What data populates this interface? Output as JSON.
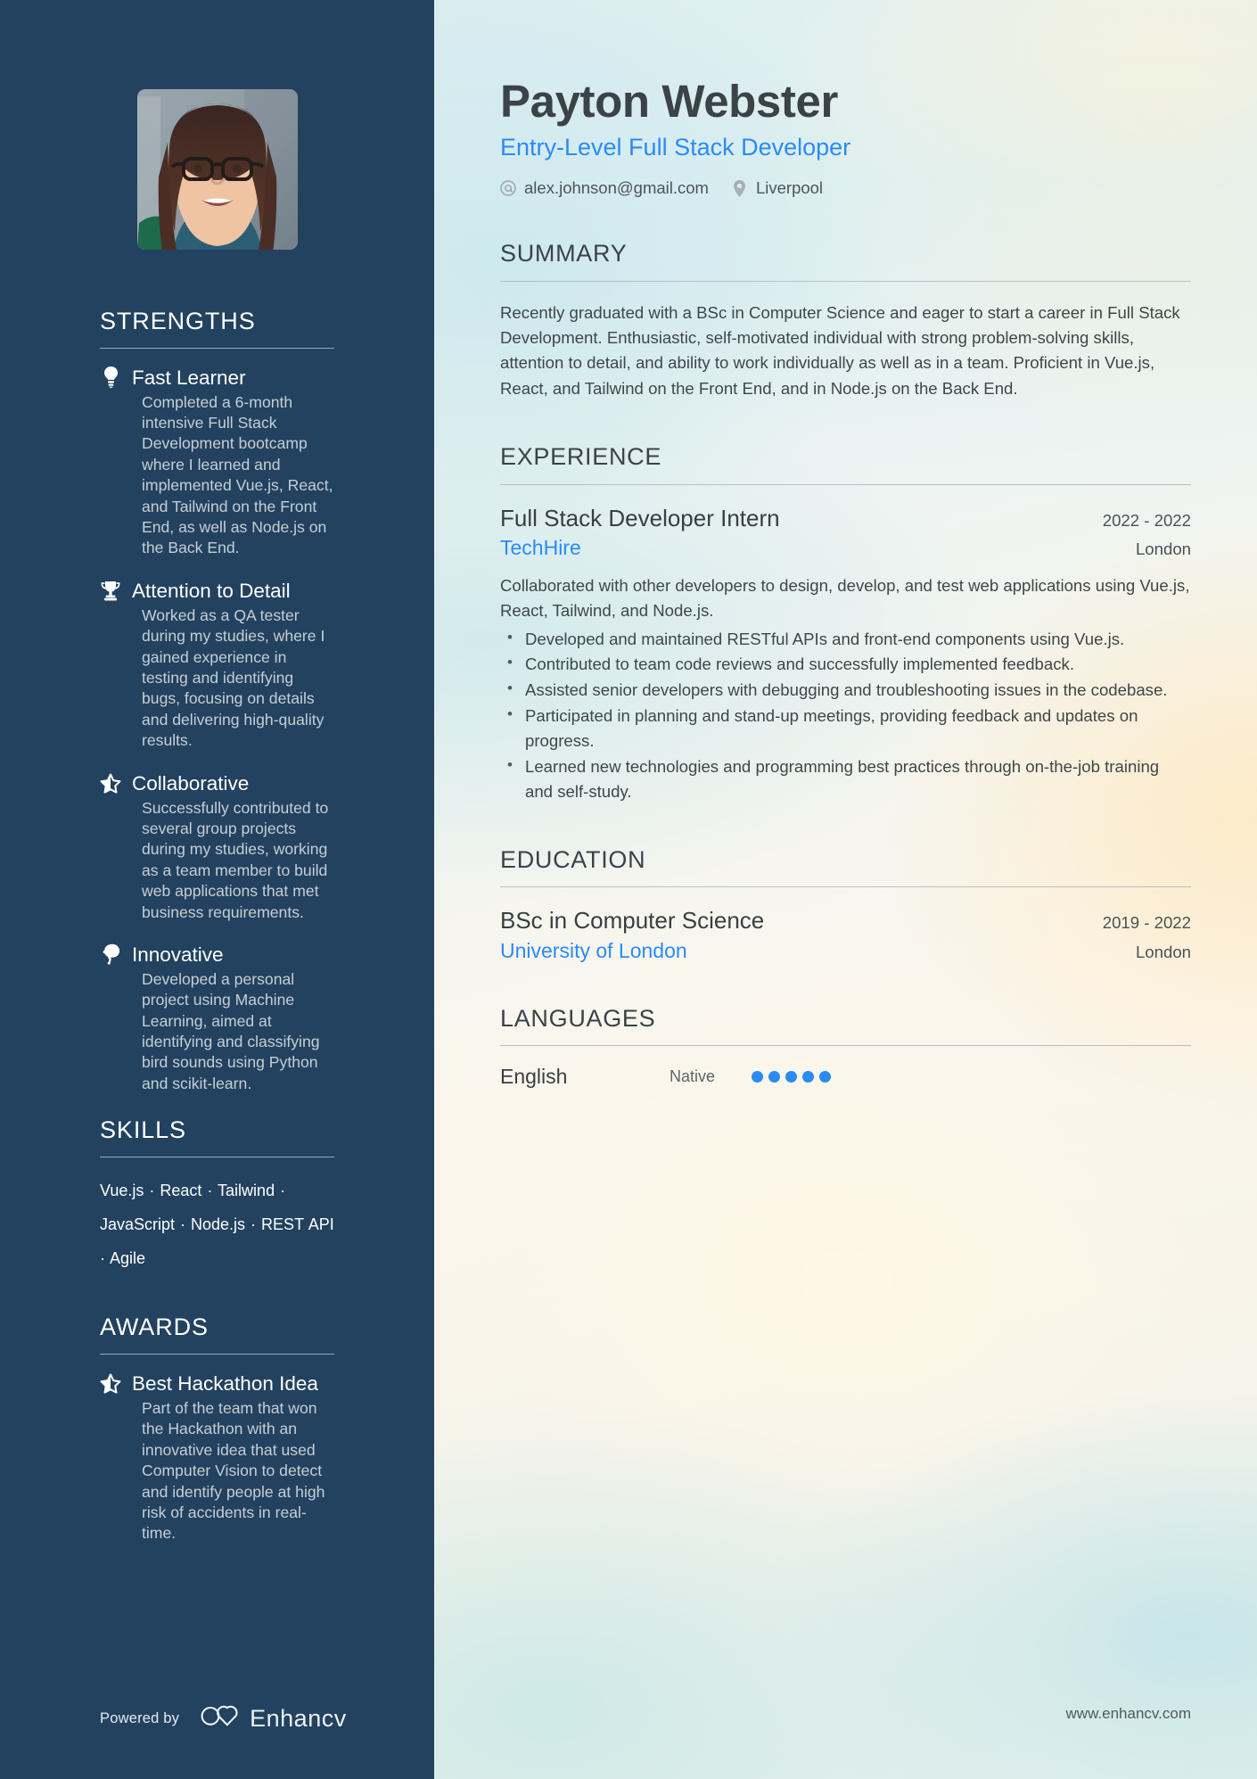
{
  "theme": {
    "sidebar_bg": "#22425f",
    "accent_blue": "#2b8bf4",
    "heading_dark": "#3b4347"
  },
  "header": {
    "name": "Payton Webster",
    "role": "Entry-Level Full Stack Developer",
    "contacts": [
      {
        "icon": "at-icon",
        "text": "alex.johnson@gmail.com"
      },
      {
        "icon": "location-pin-icon",
        "text": "Liverpool"
      }
    ]
  },
  "sidebar": {
    "photo_alt": "profile-photo",
    "strengths": {
      "heading": "STRENGTHS",
      "items": [
        {
          "icon": "lightbulb-icon",
          "title": "Fast Learner",
          "desc": "Completed a 6-month intensive Full Stack Development bootcamp where I learned and implemented Vue.js, React, and Tailwind on the Front End, as well as Node.js on the Back End."
        },
        {
          "icon": "trophy-icon",
          "title": "Attention to Detail",
          "desc": "Worked as a QA tester during my studies, where I gained experience in testing and identifying bugs, focusing on details and delivering high-quality results."
        },
        {
          "icon": "star-icon",
          "title": "Collaborative",
          "desc": "Successfully contributed to several group projects during my studies, working as a team member to build web applications that met business requirements."
        },
        {
          "icon": "head-idea-icon",
          "title": "Innovative",
          "desc": "Developed a personal project using Machine Learning, aimed at identifying and classifying bird sounds using Python and scikit-learn."
        }
      ]
    },
    "skills": {
      "heading": "SKILLS",
      "text": "Vue.js · React · Tailwind · JavaScript · Node.js · REST API · Agile",
      "list": [
        "Vue.js",
        "React",
        "Tailwind",
        "JavaScript",
        "Node.js",
        "REST API",
        "Agile"
      ]
    },
    "awards": {
      "heading": "AWARDS",
      "items": [
        {
          "icon": "star-icon",
          "title": "Best Hackathon Idea",
          "desc": "Part of the team that won the Hackathon with an innovative idea that used Computer Vision to detect and identify people at high risk of accidents in real-time."
        }
      ]
    },
    "footer": {
      "powered_by": "Powered by",
      "brand": "Enhancv",
      "logo_icon": "enhancv-logo-icon"
    }
  },
  "main": {
    "summary": {
      "heading": "SUMMARY",
      "text": "Recently graduated with a BSc in Computer Science and eager to start a career in Full Stack Development. Enthusiastic, self-motivated individual with strong problem-solving skills, attention to detail, and ability to work individually as well as in a team. Proficient in Vue.js, React, and Tailwind on the Front End, and in Node.js on the Back End."
    },
    "experience": {
      "heading": "EXPERIENCE",
      "items": [
        {
          "title": "Full Stack Developer Intern",
          "date": "2022 - 2022",
          "org": "TechHire",
          "location": "London",
          "intro": "Collaborated with other developers to design, develop, and test web applications using Vue.js, React, Tailwind, and Node.js.",
          "bullets": [
            "Developed and maintained RESTful APIs and front-end components using Vue.js.",
            "Contributed to team code reviews and successfully implemented feedback.",
            "Assisted senior developers with debugging and troubleshooting issues in the codebase.",
            "Participated in planning and stand-up meetings, providing feedback and updates on progress.",
            "Learned new technologies and programming best practices through on-the-job training and self-study."
          ]
        }
      ]
    },
    "education": {
      "heading": "EDUCATION",
      "items": [
        {
          "title": "BSc in Computer Science",
          "date": "2019 - 2022",
          "org": "University of London",
          "location": "London"
        }
      ]
    },
    "languages": {
      "heading": "LANGUAGES",
      "items": [
        {
          "name": "English",
          "level": "Native",
          "rating": 5,
          "max": 5
        }
      ]
    },
    "footer_url": "www.enhancv.com"
  }
}
